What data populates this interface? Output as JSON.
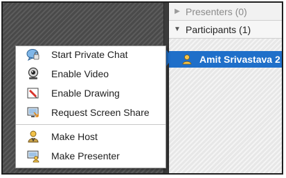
{
  "panel": {
    "presenters_label": "Presenters (0)",
    "participants_label": "Participants (1)",
    "selected_participant": "Amit Srivastava 2"
  },
  "menu": {
    "items": [
      {
        "label": "Start Private Chat",
        "icon": "chat-bubble-icon"
      },
      {
        "label": "Enable Video",
        "icon": "webcam-icon"
      },
      {
        "label": "Enable Drawing",
        "icon": "pencil-drawing-icon"
      },
      {
        "label": "Request Screen Share",
        "icon": "screen-share-icon"
      },
      {
        "label": "Make Host",
        "icon": "host-user-icon"
      },
      {
        "label": "Make Presenter",
        "icon": "presenter-icon"
      }
    ]
  },
  "colors": {
    "selection": "#1f6fc9",
    "menu_background": "#ffffff",
    "left_pane": "#4d4d4d"
  }
}
